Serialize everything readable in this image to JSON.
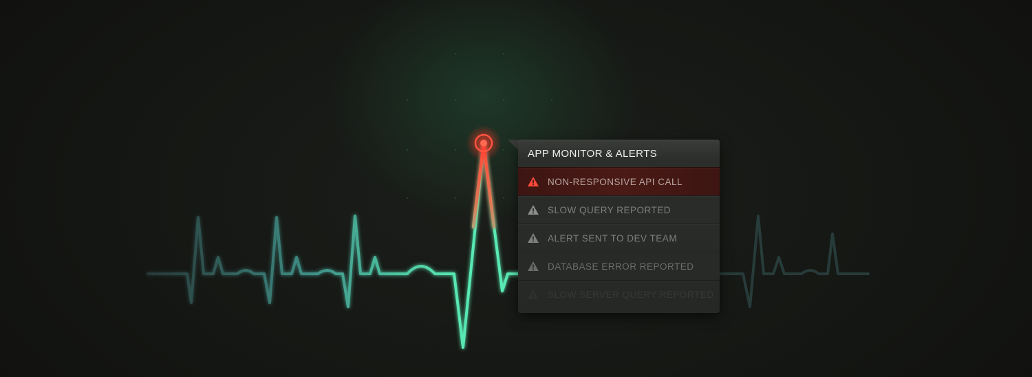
{
  "colors": {
    "background": "#151714",
    "wave_start": "#2f5a58",
    "wave_mid": "#55e0b0",
    "alert_red": "#ff4a3a",
    "panel": "#2c2e2c"
  },
  "monitor": {
    "title": "APP MONITOR & ALERTS",
    "alerts": [
      {
        "label": "NON-RESPONSIVE API CALL",
        "icon": "warning-triangle-icon",
        "state": "active"
      },
      {
        "label": "SLOW QUERY REPORTED",
        "icon": "warning-triangle-icon",
        "state": "normal"
      },
      {
        "label": "ALERT SENT TO DEV TEAM",
        "icon": "warning-triangle-icon",
        "state": "normal"
      },
      {
        "label": "DATABASE ERROR REPORTED",
        "icon": "warning-triangle-icon",
        "state": "normal"
      },
      {
        "label": "SLOW SERVER QUERY REPORTED",
        "icon": "warning-triangle-icon",
        "state": "faded"
      }
    ]
  },
  "pulse_marker": {
    "icon": "alert-pulse-icon"
  }
}
